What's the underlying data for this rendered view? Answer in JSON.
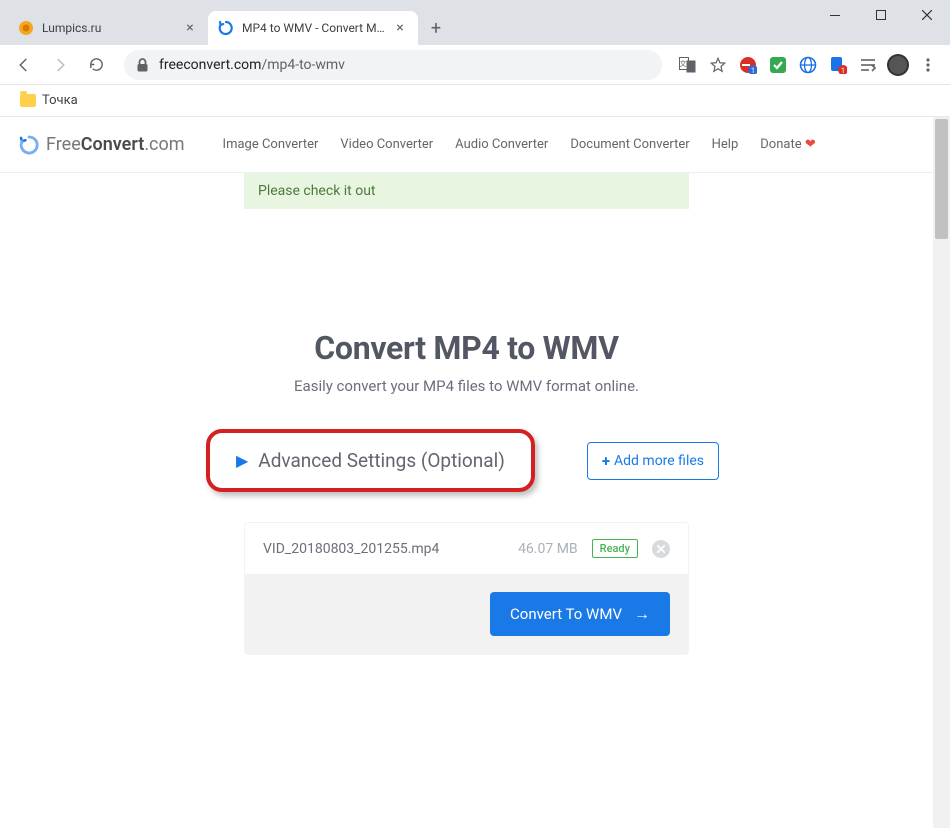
{
  "window": {
    "tabs": [
      {
        "title": "Lumpics.ru",
        "active": false,
        "favicon": "orange-circle"
      },
      {
        "title": "MP4 to WMV - Convert MP4 to W",
        "active": true,
        "favicon": "freeconvert"
      }
    ]
  },
  "toolbar": {
    "url_host": "freeconvert.com",
    "url_path": "/mp4-to-wmv"
  },
  "bookmarks": {
    "items": [
      {
        "label": "Точка"
      }
    ]
  },
  "site": {
    "brand_free": "Free",
    "brand_convert": "Convert",
    "brand_tld": ".com",
    "nav": [
      "Image Converter",
      "Video Converter",
      "Audio Converter",
      "Document Converter",
      "Help",
      "Donate"
    ],
    "notice": "Please check it out"
  },
  "main": {
    "heading": "Convert MP4 to WMV",
    "subheading": "Easily convert your MP4 files to WMV format online.",
    "advanced_label": "Advanced Settings (Optional)",
    "add_more_label": "Add more files"
  },
  "file": {
    "name": "VID_20180803_201255.mp4",
    "size": "46.07 MB",
    "status": "Ready",
    "convert_label": "Convert To WMV"
  }
}
